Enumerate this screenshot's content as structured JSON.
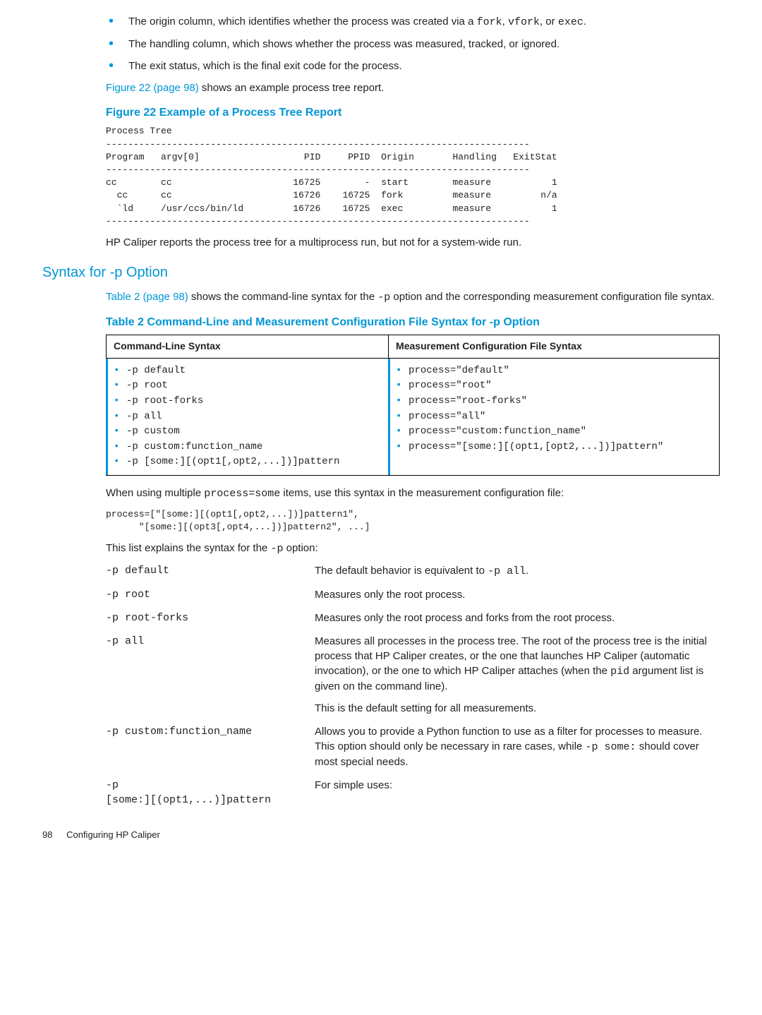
{
  "bullets": [
    {
      "prefix": "The origin column, which identifies whether the process was created via a ",
      "code1": "fork",
      "mid": ", ",
      "code2": "vfork",
      "suffix": ", or ",
      "code3": "exec",
      "end": "."
    },
    {
      "text": "The handling column, which shows whether the process was measured, tracked, or ignored."
    },
    {
      "text": "The exit status, which is the final exit code for the process."
    }
  ],
  "fig_ref_link": "Figure 22 (page 98)",
  "fig_ref_suffix": " shows an example process tree report.",
  "figure_title": "Figure 22 Example of a Process Tree Report",
  "process_tree": "Process Tree\n-----------------------------------------------------------------------------\nProgram   argv[0]                   PID     PPID  Origin       Handling   ExitStat\n-----------------------------------------------------------------------------\ncc        cc                      16725        -  start        measure           1\n  cc      cc                      16726    16725  fork         measure         n/a\n  `ld     /usr/ccs/bin/ld         16726    16725  exec         measure           1\n-----------------------------------------------------------------------------",
  "after_tree": "HP Caliper reports the process tree for a multiprocess run, but not for a system-wide run.",
  "h2": "Syntax for -p Option",
  "table_ref_link": "Table 2 (page 98)",
  "table_ref_mid": " shows the command-line syntax for the ",
  "table_ref_code": "-p",
  "table_ref_end": " option and the corresponding measurement configuration file syntax.",
  "table_title": "Table 2 Command-Line and Measurement Configuration File Syntax for -p Option",
  "table": {
    "head": [
      "Command-Line Syntax",
      "Measurement Configuration File Syntax"
    ],
    "left": [
      "-p default",
      "-p root",
      "-p root-forks",
      "-p all",
      "-p custom",
      "-p custom:function_name",
      "-p [some:][(opt1[,opt2,...])]pattern"
    ],
    "right": [
      "process=\"default\"",
      "process=\"root\"",
      "process=\"root-forks\"",
      "process=\"all\"",
      "process=\"custom:function_name\"",
      "process=\"[some:][(opt1,[opt2,...])]pattern\""
    ]
  },
  "multi_para_prefix": "When using multiple ",
  "multi_para_code": "process=some",
  "multi_para_suffix": " items, use this syntax in the measurement configuration file:",
  "multi_code": "process=[\"[some:][(opt1[,opt2,...])]pattern1\",\n      \"[some:][(opt3[,opt4,...])]pattern2\", ...]",
  "explain_prefix": "This list explains the syntax for the ",
  "explain_code": "-p",
  "explain_suffix": " option:",
  "defs": [
    {
      "term": "-p default",
      "desc_pre": "The default behavior is equivalent to ",
      "desc_code": "-p all",
      "desc_post": "."
    },
    {
      "term": "-p root",
      "desc": "Measures only the root process."
    },
    {
      "term": "-p root-forks",
      "desc": "Measures only the root process and forks from the root process."
    },
    {
      "term": "-p all",
      "desc_pre": "Measures all processes in the process tree. The root of the process tree is the initial process that HP Caliper creates, or the one that launches HP Caliper (automatic invocation), or the one to which HP Caliper attaches (when the ",
      "desc_code": "pid",
      "desc_post": " argument list is given on the command line).",
      "extra": "This is the default setting for all measurements."
    },
    {
      "term": "-p custom:function_name",
      "desc_pre": "Allows you to provide a Python function to use as a filter for processes to measure. This option should only be necessary in rare cases, while ",
      "desc_code": "-p some:",
      "desc_post": " should cover most special needs."
    },
    {
      "term": "-p\n[some:][(opt1,...)]pattern",
      "desc": "For simple uses:"
    }
  ],
  "footer": {
    "page": "98",
    "title": "Configuring HP Caliper"
  }
}
